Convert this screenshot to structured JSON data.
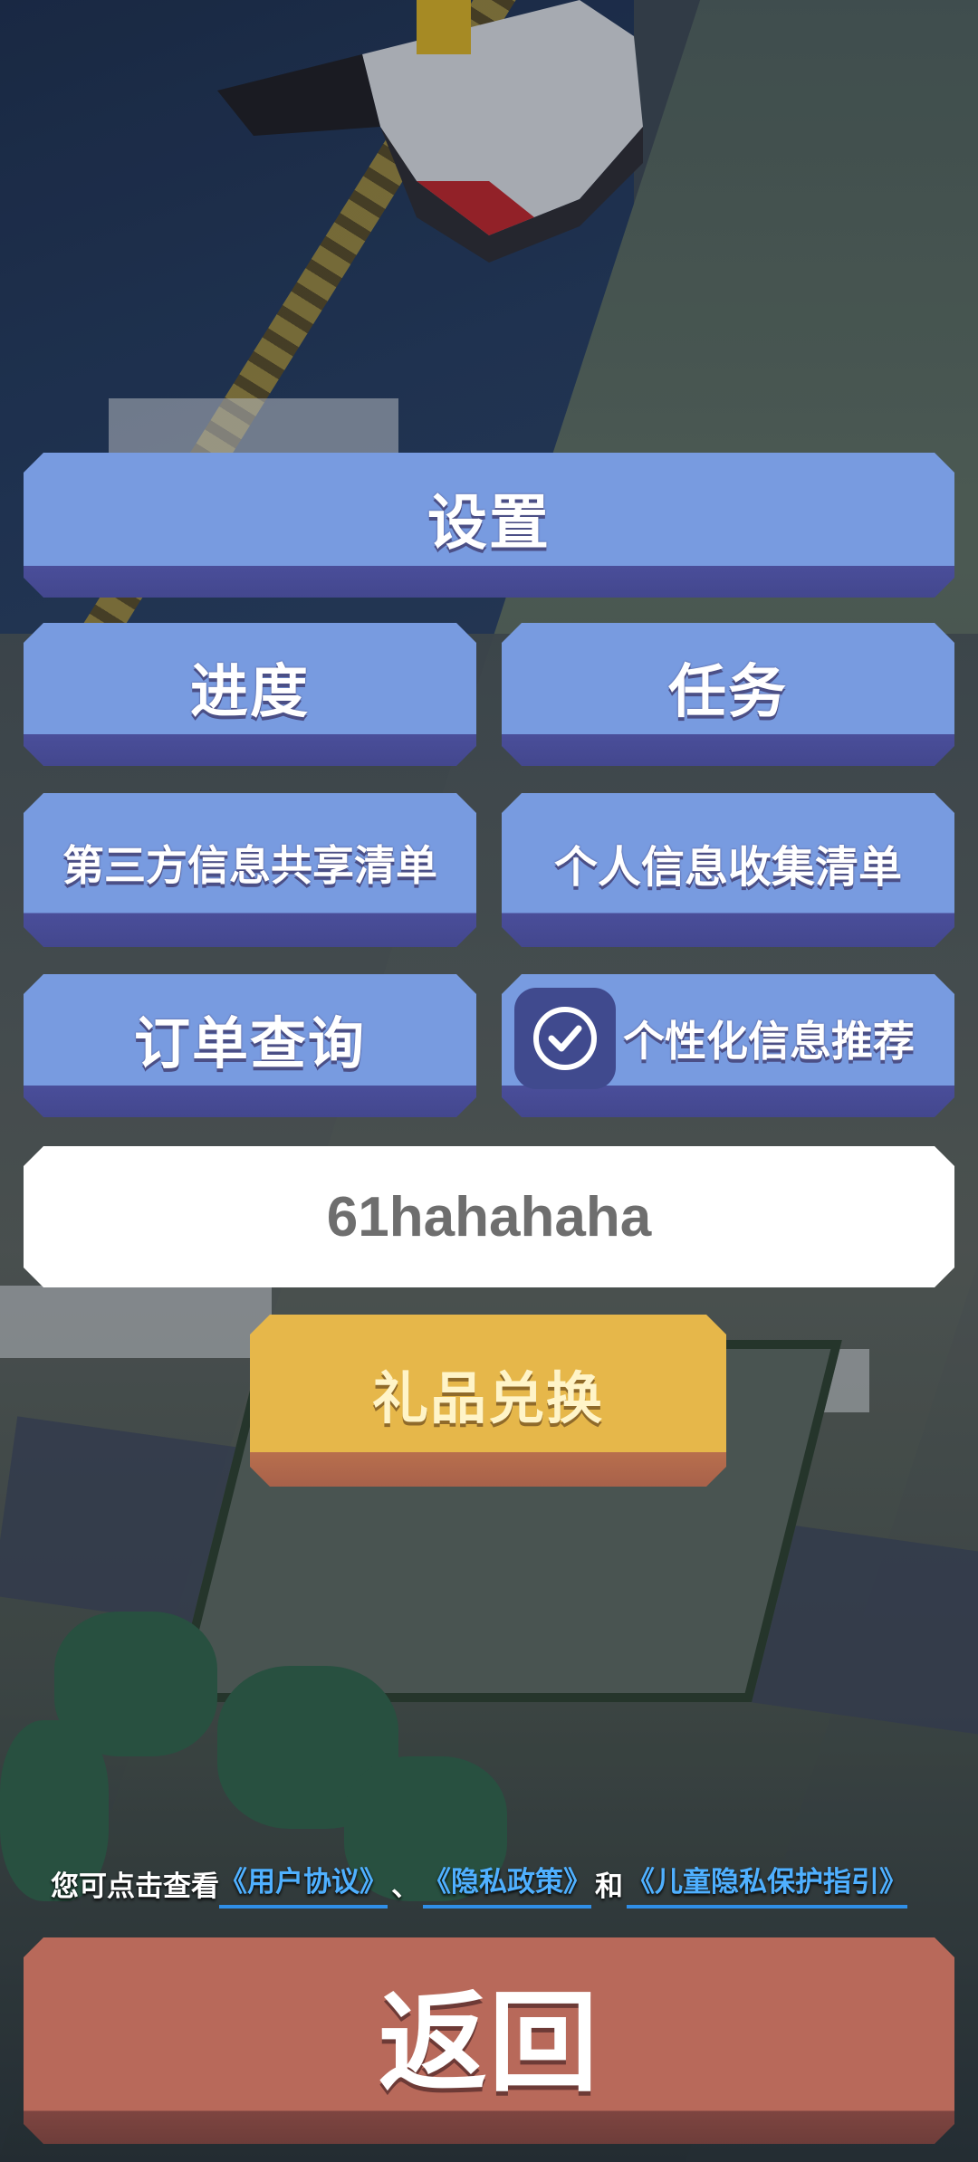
{
  "menu": {
    "settings": "设置",
    "progress": "进度",
    "tasks": "任务",
    "third_party_list": "第三方信息共享清单",
    "personal_info_list": "个人信息收集清单",
    "order_query": "订单查询",
    "personalized_recommend": "个性化信息推荐",
    "personalized_recommend_checked": true
  },
  "gift_code": {
    "value": "61hahahaha"
  },
  "gift_redeem": "礼品兑换",
  "legal": {
    "prefix": "您可点击查看",
    "user_agreement": "《用户协议》",
    "separator": "、",
    "privacy_policy": "《隐私政策》",
    "and": "和",
    "child_privacy": "《儿童隐私保护指引》"
  },
  "back": "返回",
  "colors": {
    "button_blue": "#789be0",
    "button_gold": "#e6b74a",
    "button_back": "#b8695a",
    "link_blue": "#4fb0ff"
  }
}
